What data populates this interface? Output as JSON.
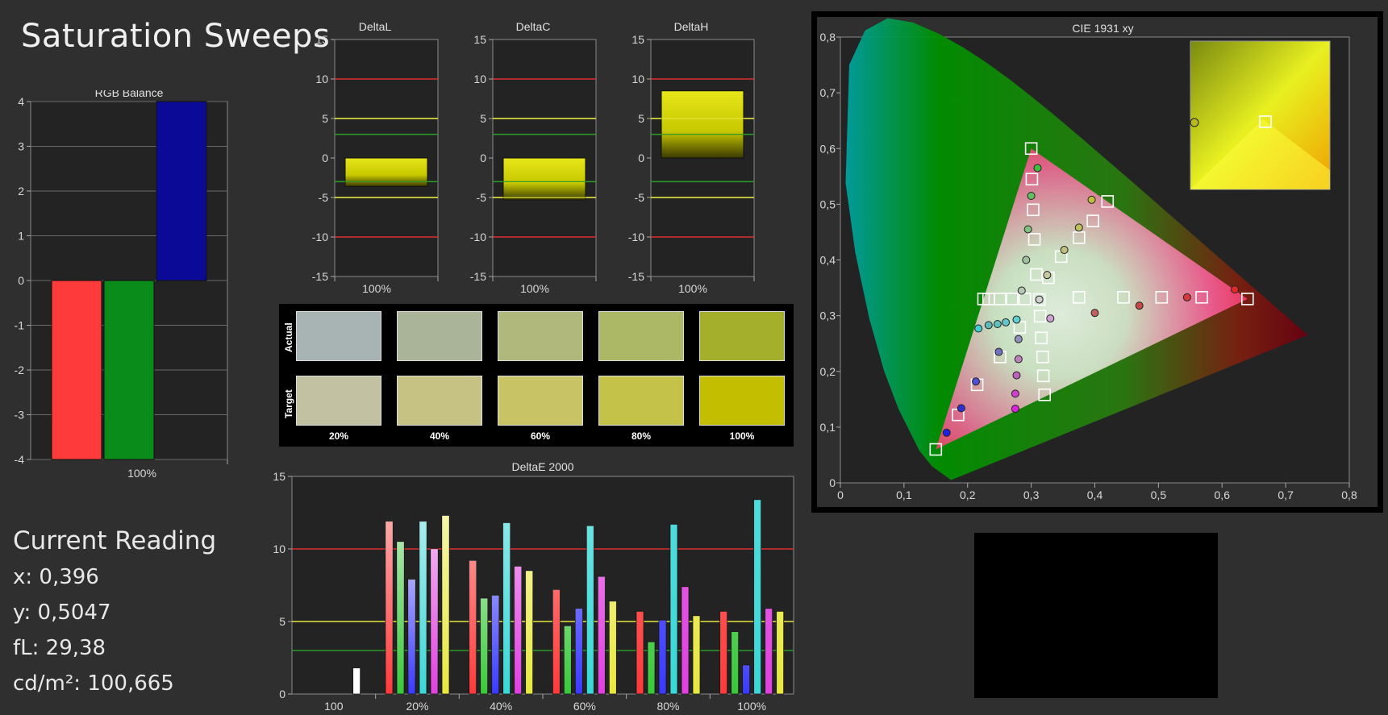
{
  "page": {
    "title": "Saturation Sweeps"
  },
  "colors": {
    "background": "#2f2f2f",
    "plot_bg": "#232323",
    "red_limit": "#e03030",
    "yellow_limit": "#e6e640",
    "green_limit": "#2a9a2a"
  },
  "reading": {
    "header": "Current Reading",
    "x": "x: 0,396",
    "y": "y: 0,5047",
    "fl": "fL: 29,38",
    "cdm2": "cd/m²: 100,665"
  },
  "swatches": {
    "actual_label": "Actual",
    "target_label": "Target",
    "captions": [
      "20%",
      "40%",
      "60%",
      "80%",
      "100%"
    ],
    "actual_colors": [
      "#a8b4b4",
      "#aab498",
      "#b0b87c",
      "#acb866",
      "#a4b02c"
    ],
    "target_colors": [
      "#c2c2a2",
      "#c6c284",
      "#c8c466",
      "#c4c248",
      "#c4be00"
    ]
  },
  "chart_data": [
    {
      "id": "rgb",
      "type": "bar",
      "title": "RGB Balance",
      "categories": [
        "100%"
      ],
      "series": [
        {
          "name": "R",
          "color": "#ff3a3a",
          "values": [
            -4
          ]
        },
        {
          "name": "G",
          "color": "#0a8c1a",
          "values": [
            -4
          ]
        },
        {
          "name": "B",
          "color": "#0a0a96",
          "values": [
            4
          ]
        }
      ],
      "ylim": [
        -4,
        4
      ],
      "yticks": [
        "-4",
        "-3",
        "-2",
        "-1",
        "0",
        "1",
        "2",
        "3",
        "4"
      ]
    },
    {
      "id": "deltaL",
      "type": "bar",
      "title": "DeltaL",
      "categories": [
        "100%"
      ],
      "values": [
        -3.6
      ],
      "ylim": [
        -15,
        15
      ],
      "yticks": [
        "-15",
        "-10",
        "-5",
        "0",
        "5",
        "10",
        "15"
      ],
      "limits": {
        "red": 10,
        "yellow": 5,
        "green": 3
      }
    },
    {
      "id": "deltaC",
      "type": "bar",
      "title": "DeltaC",
      "categories": [
        "100%"
      ],
      "values": [
        -5.3
      ],
      "ylim": [
        -15,
        15
      ],
      "yticks": [
        "-15",
        "-10",
        "-5",
        "0",
        "5",
        "10",
        "15"
      ],
      "limits": {
        "red": 10,
        "yellow": 5,
        "green": 3
      }
    },
    {
      "id": "deltaH",
      "type": "bar",
      "title": "DeltaH",
      "categories": [
        "100%"
      ],
      "values": [
        8.5
      ],
      "ylim": [
        -15,
        15
      ],
      "yticks": [
        "-15",
        "-10",
        "-5",
        "0",
        "5",
        "10",
        "15"
      ],
      "limits": {
        "red": 10,
        "yellow": 5,
        "green": 3
      }
    },
    {
      "id": "deltaE",
      "type": "bar",
      "title": "DeltaE 2000",
      "categories": [
        "100",
        "20%",
        "40%",
        "60%",
        "80%",
        "100%"
      ],
      "series_colors": [
        "#ff3a3a",
        "#3ac83a",
        "#3a3aff",
        "#3ad8d8",
        "#e040e0",
        "#e8e840"
      ],
      "groups": [
        {
          "label": "100",
          "values": [
            1.8
          ],
          "colors": [
            "#ffffff"
          ]
        },
        {
          "label": "20%",
          "values": [
            11.9,
            10.5,
            7.9,
            11.9,
            10.0,
            12.3
          ]
        },
        {
          "label": "40%",
          "values": [
            9.2,
            6.6,
            6.8,
            11.8,
            8.8,
            8.5
          ]
        },
        {
          "label": "60%",
          "values": [
            7.2,
            4.7,
            5.9,
            11.6,
            8.1,
            6.4
          ]
        },
        {
          "label": "80%",
          "values": [
            5.7,
            3.6,
            5.1,
            11.7,
            7.4,
            5.4
          ]
        },
        {
          "label": "100%",
          "values": [
            5.7,
            4.3,
            2.0,
            13.4,
            5.9,
            5.7
          ]
        }
      ],
      "ylim": [
        0,
        15
      ],
      "yticks": [
        "0",
        "5",
        "10",
        "15"
      ],
      "limits": {
        "red": 10,
        "yellow": 5,
        "green": 3
      }
    },
    {
      "id": "cie",
      "type": "scatter",
      "title": "CIE 1931 xy",
      "xlim": [
        0,
        0.8
      ],
      "ylim": [
        0,
        0.8
      ],
      "xticks": [
        "0",
        "0,1",
        "0,2",
        "0,3",
        "0,4",
        "0,5",
        "0,6",
        "0,7",
        "0,8"
      ],
      "yticks": [
        "0",
        "0,1",
        "0,2",
        "0,3",
        "0,4",
        "0,5",
        "0,6",
        "0,7",
        "0,8"
      ],
      "gamut": [
        [
          0.64,
          0.33
        ],
        [
          0.3,
          0.6
        ],
        [
          0.15,
          0.06
        ]
      ],
      "white": [
        0.3127,
        0.329
      ],
      "targets": [
        [
          0.3127,
          0.329
        ],
        [
          0.375,
          0.333
        ],
        [
          0.445,
          0.333
        ],
        [
          0.505,
          0.333
        ],
        [
          0.568,
          0.333
        ],
        [
          0.64,
          0.33
        ],
        [
          0.308,
          0.374
        ],
        [
          0.305,
          0.437
        ],
        [
          0.303,
          0.49
        ],
        [
          0.301,
          0.545
        ],
        [
          0.3,
          0.6
        ],
        [
          0.282,
          0.279
        ],
        [
          0.251,
          0.226
        ],
        [
          0.215,
          0.176
        ],
        [
          0.185,
          0.122
        ],
        [
          0.15,
          0.06
        ],
        [
          0.327,
          0.368
        ],
        [
          0.347,
          0.406
        ],
        [
          0.375,
          0.44
        ],
        [
          0.397,
          0.47
        ],
        [
          0.42,
          0.505
        ],
        [
          0.29,
          0.33
        ],
        [
          0.27,
          0.33
        ],
        [
          0.251,
          0.33
        ],
        [
          0.233,
          0.33
        ],
        [
          0.225,
          0.33
        ],
        [
          0.314,
          0.299
        ],
        [
          0.316,
          0.26
        ],
        [
          0.318,
          0.226
        ],
        [
          0.319,
          0.192
        ],
        [
          0.321,
          0.158
        ]
      ],
      "measured": [
        {
          "x": 0.3127,
          "y": 0.329,
          "c": "#d0d0d0"
        },
        {
          "x": 0.4,
          "y": 0.305,
          "c": "#c06060"
        },
        {
          "x": 0.47,
          "y": 0.318,
          "c": "#c84848"
        },
        {
          "x": 0.545,
          "y": 0.333,
          "c": "#d83a3a"
        },
        {
          "x": 0.62,
          "y": 0.347,
          "c": "#e02a2a"
        },
        {
          "x": 0.31,
          "y": 0.565,
          "c": "#40c040"
        },
        {
          "x": 0.3,
          "y": 0.515,
          "c": "#60c060"
        },
        {
          "x": 0.295,
          "y": 0.455,
          "c": "#80c080"
        },
        {
          "x": 0.292,
          "y": 0.4,
          "c": "#a0c0a0"
        },
        {
          "x": 0.285,
          "y": 0.345,
          "c": "#b8c8b8"
        },
        {
          "x": 0.395,
          "y": 0.508,
          "c": "#c0c040"
        },
        {
          "x": 0.375,
          "y": 0.458,
          "c": "#c0c060"
        },
        {
          "x": 0.352,
          "y": 0.418,
          "c": "#c0c080"
        },
        {
          "x": 0.325,
          "y": 0.373,
          "c": "#c8c8a0"
        },
        {
          "x": 0.277,
          "y": 0.293,
          "c": "#60d0d0"
        },
        {
          "x": 0.26,
          "y": 0.288,
          "c": "#60c8c8"
        },
        {
          "x": 0.247,
          "y": 0.285,
          "c": "#60c0c0"
        },
        {
          "x": 0.233,
          "y": 0.283,
          "c": "#60b8b8"
        },
        {
          "x": 0.217,
          "y": 0.277,
          "c": "#40d0d0"
        },
        {
          "x": 0.28,
          "y": 0.258,
          "c": "#9090c0"
        },
        {
          "x": 0.249,
          "y": 0.235,
          "c": "#7070c0"
        },
        {
          "x": 0.213,
          "y": 0.182,
          "c": "#5050d0"
        },
        {
          "x": 0.19,
          "y": 0.134,
          "c": "#3030d0"
        },
        {
          "x": 0.167,
          "y": 0.09,
          "c": "#2020e0"
        },
        {
          "x": 0.33,
          "y": 0.295,
          "c": "#d0a0d0"
        },
        {
          "x": 0.28,
          "y": 0.222,
          "c": "#c080c0"
        },
        {
          "x": 0.277,
          "y": 0.193,
          "c": "#c060c0"
        },
        {
          "x": 0.275,
          "y": 0.16,
          "c": "#d040d0"
        },
        {
          "x": 0.275,
          "y": 0.133,
          "c": "#e020e0"
        }
      ],
      "zoom": {
        "measured": [
          0.396,
          0.5047
        ],
        "target": [
          0.42,
          0.505
        ]
      }
    }
  ]
}
